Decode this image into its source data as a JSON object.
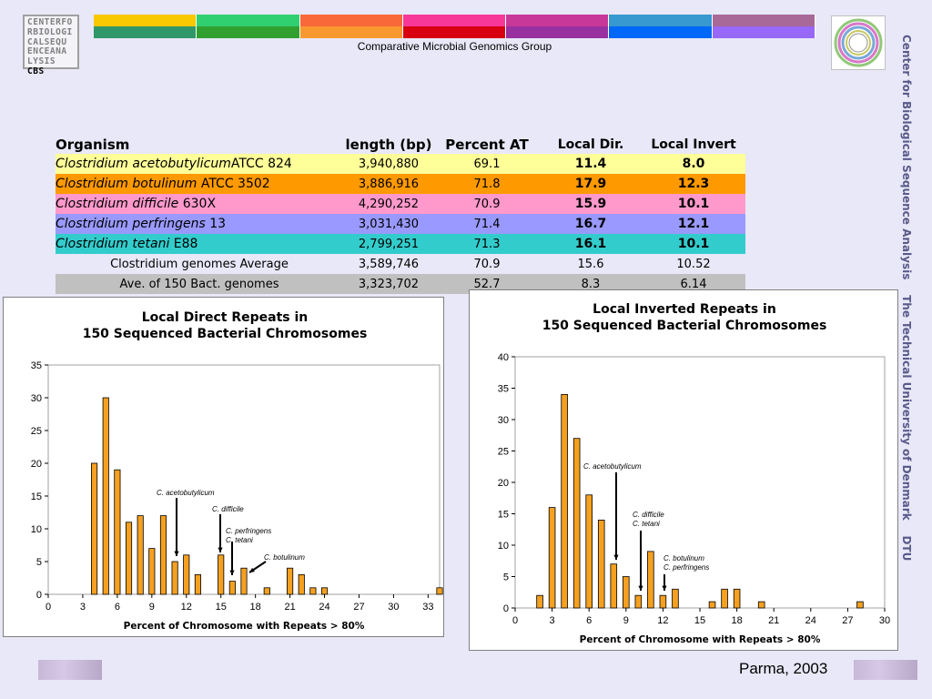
{
  "header": {
    "logo_lines": [
      "CENTERFO",
      "RBIOLOGI",
      "CALSEQU",
      "ENCEANA",
      "LYSIS"
    ],
    "logo_cbs": "CBS",
    "group_name": "Comparative Microbial Genomics Group",
    "band_top_colors": [
      "#f8c800",
      "#30d070",
      "#f86838",
      "#f83898",
      "#c83898",
      "#3898d0",
      "#a86898"
    ],
    "band_bottom_colors": [
      "#309868",
      "#30a030",
      "#f89830",
      "#d80010",
      "#9830a0",
      "#0068f8",
      "#9868f8"
    ]
  },
  "side_text": "Center for Biological Sequence Analysis    The Technical University of Denmark    DTU",
  "table": {
    "headers": [
      "Organism",
      "length (bp)",
      "Percent AT",
      "Local Dir.",
      "Local Invert"
    ],
    "rows": [
      {
        "species": "Clostridium acetobutylicum",
        "strain": "ATCC 824",
        "length": "3,940,880",
        "at": "69.1",
        "dir": "11.4",
        "inv": "8.0",
        "color": "#ffff99"
      },
      {
        "species": "Clostridium botulinum",
        "strain": " ATCC 3502",
        "length": "3,886,916",
        "at": "71.8",
        "dir": "17.9",
        "inv": "12.3",
        "color": "#ff9900"
      },
      {
        "species": "Clostridium difficile",
        "strain": "  630X",
        "length": "4,290,252",
        "at": "70.9",
        "dir": "15.9",
        "inv": "10.1",
        "color": "#ff99cc"
      },
      {
        "species": "Clostridium perfringens",
        "strain": "   13",
        "length": "3,031,430",
        "at": "71.4",
        "dir": "16.7",
        "inv": "12.1",
        "color": "#9999ff"
      },
      {
        "species": "Clostridium tetani",
        "strain": "  E88",
        "length": "2,799,251",
        "at": "71.3",
        "dir": "16.1",
        "inv": "10.1",
        "color": "#33cccc"
      }
    ],
    "summary_rows": [
      {
        "label": "Clostridium genomes Average",
        "length": "3,589,746",
        "at": "70.9",
        "dir": "15.6",
        "inv": "10.52",
        "color": "#e8e8f8"
      },
      {
        "label": "Ave. of 150 Bact. genomes",
        "length": "3,323,702",
        "at": "52.7",
        "dir": "8.3",
        "inv": "6.14",
        "color": "#c0c0c0"
      }
    ]
  },
  "chart_data": [
    {
      "type": "bar",
      "title": "Local Direct Repeats in\n150 Sequenced Bacterial Chromosomes",
      "xlabel": "Percent of Chromosome with Repeats > 80%",
      "ylabel": "",
      "ylim": [
        0,
        35
      ],
      "yticks": [
        0,
        5,
        10,
        15,
        20,
        25,
        30,
        35
      ],
      "xlim": [
        0,
        34
      ],
      "xticks": [
        0,
        3,
        6,
        9,
        12,
        15,
        18,
        21,
        24,
        27,
        30,
        33
      ],
      "bar_color": "#f5a020",
      "x": [
        4,
        5,
        6,
        7,
        8,
        9,
        10,
        11,
        12,
        13,
        15,
        16,
        17,
        19,
        21,
        22,
        23,
        24,
        34
      ],
      "values": [
        20,
        30,
        19,
        11,
        12,
        7,
        12,
        5,
        6,
        3,
        6,
        2,
        4,
        1,
        4,
        3,
        1,
        1,
        1
      ],
      "annotations": [
        {
          "text": "C. acetobutylicum",
          "x": 11.4
        },
        {
          "text": "C. difficile",
          "x": 15.9
        },
        {
          "text": "C. perfringens\nC. tetani",
          "x": 16.4
        },
        {
          "text": "C. botulinum",
          "x": 17.9
        }
      ]
    },
    {
      "type": "bar",
      "title": "Local Inverted Repeats in\n150 Sequenced Bacterial Chromosomes",
      "xlabel": "Percent of Chromosome with Repeats > 80%",
      "ylabel": "",
      "ylim": [
        0,
        40
      ],
      "yticks": [
        0,
        5,
        10,
        15,
        20,
        25,
        30,
        35,
        40
      ],
      "xlim": [
        0,
        30
      ],
      "xticks": [
        0,
        3,
        6,
        9,
        12,
        15,
        18,
        21,
        24,
        27,
        30
      ],
      "bar_color": "#f5a020",
      "x": [
        2,
        3,
        4,
        5,
        6,
        7,
        8,
        9,
        10,
        11,
        12,
        13,
        16,
        17,
        18,
        20,
        28
      ],
      "values": [
        2,
        16,
        34,
        27,
        18,
        14,
        7,
        5,
        2,
        9,
        2,
        3,
        1,
        3,
        3,
        1,
        1
      ],
      "annotations": [
        {
          "text": "C. acetobutylicum",
          "x": 8.0
        },
        {
          "text": "C. difficile\nC. tetani",
          "x": 10.1
        },
        {
          "text": "C. botulinum\nC. perfringens",
          "x": 12.2
        }
      ]
    }
  ],
  "footer": {
    "text": "Parma, 2003"
  }
}
